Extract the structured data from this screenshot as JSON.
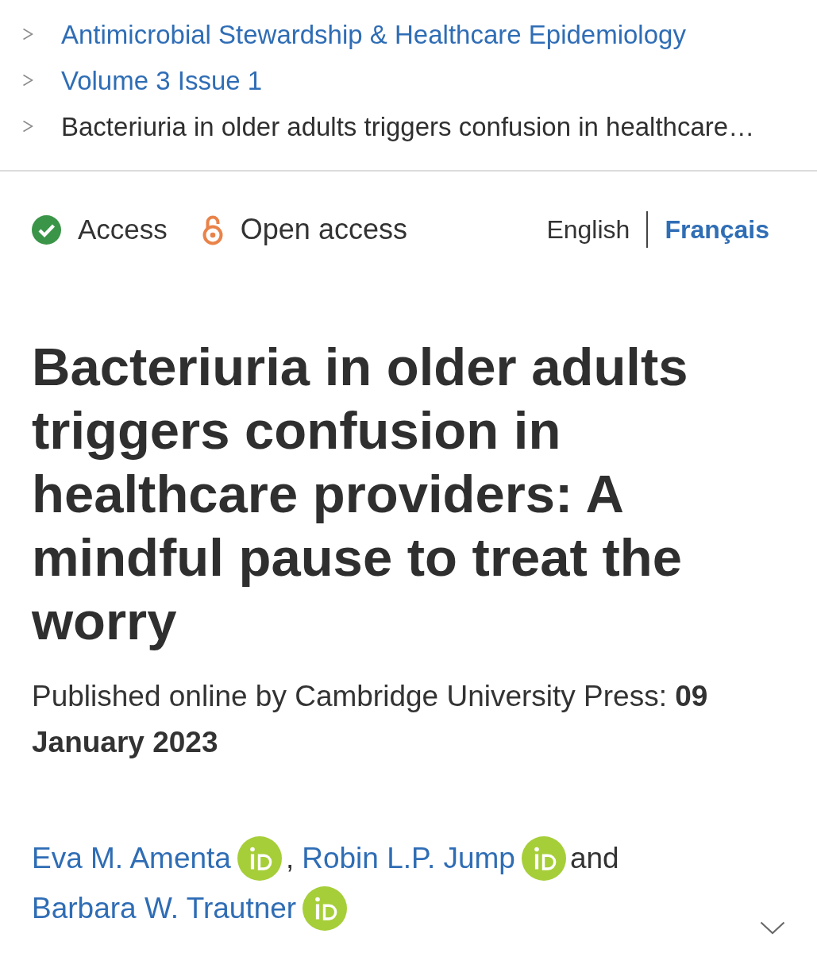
{
  "breadcrumb": [
    {
      "label": "Antimicrobial Stewardship & Healthcare Epidemiology",
      "kind": "link"
    },
    {
      "label": "Volume 3 Issue 1",
      "kind": "link"
    },
    {
      "label": "Bacteriuria in older adults triggers confusion in healthcare…",
      "kind": "current"
    }
  ],
  "access": {
    "label": "Access"
  },
  "open_access": {
    "label": "Open access"
  },
  "languages": [
    {
      "label": "English",
      "selected": false
    },
    {
      "label": "Français",
      "selected": true
    }
  ],
  "title": "Bacteriuria in older adults triggers confusion in healthcare providers: A mindful pause to treat the worry",
  "published": "Published online by Cambridge University Press: **09 January 2023**",
  "authors": [
    {
      "name": "Eva M. Amenta",
      "orcid": true,
      "separator": ","
    },
    {
      "name": "Robin L.P. Jump",
      "orcid": true,
      "separator": "and"
    },
    {
      "name": "Barbara W. Trautner",
      "orcid": true
    }
  ]
}
